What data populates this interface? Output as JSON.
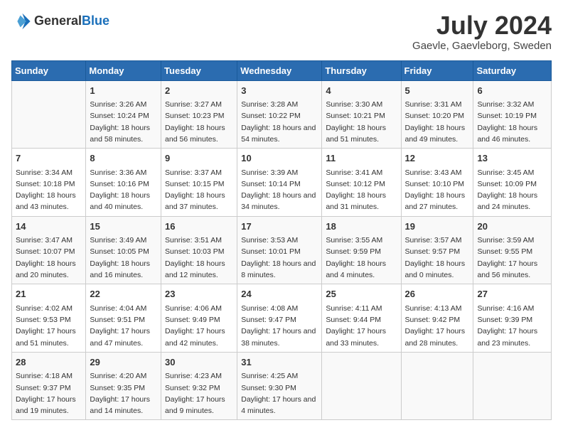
{
  "header": {
    "logo_general": "General",
    "logo_blue": "Blue",
    "month_year": "July 2024",
    "location": "Gaevle, Gaevleborg, Sweden"
  },
  "columns": [
    "Sunday",
    "Monday",
    "Tuesday",
    "Wednesday",
    "Thursday",
    "Friday",
    "Saturday"
  ],
  "weeks": [
    [
      {
        "day": "",
        "sunrise": "",
        "sunset": "",
        "daylight": ""
      },
      {
        "day": "1",
        "sunrise": "Sunrise: 3:26 AM",
        "sunset": "Sunset: 10:24 PM",
        "daylight": "Daylight: 18 hours and 58 minutes."
      },
      {
        "day": "2",
        "sunrise": "Sunrise: 3:27 AM",
        "sunset": "Sunset: 10:23 PM",
        "daylight": "Daylight: 18 hours and 56 minutes."
      },
      {
        "day": "3",
        "sunrise": "Sunrise: 3:28 AM",
        "sunset": "Sunset: 10:22 PM",
        "daylight": "Daylight: 18 hours and 54 minutes."
      },
      {
        "day": "4",
        "sunrise": "Sunrise: 3:30 AM",
        "sunset": "Sunset: 10:21 PM",
        "daylight": "Daylight: 18 hours and 51 minutes."
      },
      {
        "day": "5",
        "sunrise": "Sunrise: 3:31 AM",
        "sunset": "Sunset: 10:20 PM",
        "daylight": "Daylight: 18 hours and 49 minutes."
      },
      {
        "day": "6",
        "sunrise": "Sunrise: 3:32 AM",
        "sunset": "Sunset: 10:19 PM",
        "daylight": "Daylight: 18 hours and 46 minutes."
      }
    ],
    [
      {
        "day": "7",
        "sunrise": "Sunrise: 3:34 AM",
        "sunset": "Sunset: 10:18 PM",
        "daylight": "Daylight: 18 hours and 43 minutes."
      },
      {
        "day": "8",
        "sunrise": "Sunrise: 3:36 AM",
        "sunset": "Sunset: 10:16 PM",
        "daylight": "Daylight: 18 hours and 40 minutes."
      },
      {
        "day": "9",
        "sunrise": "Sunrise: 3:37 AM",
        "sunset": "Sunset: 10:15 PM",
        "daylight": "Daylight: 18 hours and 37 minutes."
      },
      {
        "day": "10",
        "sunrise": "Sunrise: 3:39 AM",
        "sunset": "Sunset: 10:14 PM",
        "daylight": "Daylight: 18 hours and 34 minutes."
      },
      {
        "day": "11",
        "sunrise": "Sunrise: 3:41 AM",
        "sunset": "Sunset: 10:12 PM",
        "daylight": "Daylight: 18 hours and 31 minutes."
      },
      {
        "day": "12",
        "sunrise": "Sunrise: 3:43 AM",
        "sunset": "Sunset: 10:10 PM",
        "daylight": "Daylight: 18 hours and 27 minutes."
      },
      {
        "day": "13",
        "sunrise": "Sunrise: 3:45 AM",
        "sunset": "Sunset: 10:09 PM",
        "daylight": "Daylight: 18 hours and 24 minutes."
      }
    ],
    [
      {
        "day": "14",
        "sunrise": "Sunrise: 3:47 AM",
        "sunset": "Sunset: 10:07 PM",
        "daylight": "Daylight: 18 hours and 20 minutes."
      },
      {
        "day": "15",
        "sunrise": "Sunrise: 3:49 AM",
        "sunset": "Sunset: 10:05 PM",
        "daylight": "Daylight: 18 hours and 16 minutes."
      },
      {
        "day": "16",
        "sunrise": "Sunrise: 3:51 AM",
        "sunset": "Sunset: 10:03 PM",
        "daylight": "Daylight: 18 hours and 12 minutes."
      },
      {
        "day": "17",
        "sunrise": "Sunrise: 3:53 AM",
        "sunset": "Sunset: 10:01 PM",
        "daylight": "Daylight: 18 hours and 8 minutes."
      },
      {
        "day": "18",
        "sunrise": "Sunrise: 3:55 AM",
        "sunset": "Sunset: 9:59 PM",
        "daylight": "Daylight: 18 hours and 4 minutes."
      },
      {
        "day": "19",
        "sunrise": "Sunrise: 3:57 AM",
        "sunset": "Sunset: 9:57 PM",
        "daylight": "Daylight: 18 hours and 0 minutes."
      },
      {
        "day": "20",
        "sunrise": "Sunrise: 3:59 AM",
        "sunset": "Sunset: 9:55 PM",
        "daylight": "Daylight: 17 hours and 56 minutes."
      }
    ],
    [
      {
        "day": "21",
        "sunrise": "Sunrise: 4:02 AM",
        "sunset": "Sunset: 9:53 PM",
        "daylight": "Daylight: 17 hours and 51 minutes."
      },
      {
        "day": "22",
        "sunrise": "Sunrise: 4:04 AM",
        "sunset": "Sunset: 9:51 PM",
        "daylight": "Daylight: 17 hours and 47 minutes."
      },
      {
        "day": "23",
        "sunrise": "Sunrise: 4:06 AM",
        "sunset": "Sunset: 9:49 PM",
        "daylight": "Daylight: 17 hours and 42 minutes."
      },
      {
        "day": "24",
        "sunrise": "Sunrise: 4:08 AM",
        "sunset": "Sunset: 9:47 PM",
        "daylight": "Daylight: 17 hours and 38 minutes."
      },
      {
        "day": "25",
        "sunrise": "Sunrise: 4:11 AM",
        "sunset": "Sunset: 9:44 PM",
        "daylight": "Daylight: 17 hours and 33 minutes."
      },
      {
        "day": "26",
        "sunrise": "Sunrise: 4:13 AM",
        "sunset": "Sunset: 9:42 PM",
        "daylight": "Daylight: 17 hours and 28 minutes."
      },
      {
        "day": "27",
        "sunrise": "Sunrise: 4:16 AM",
        "sunset": "Sunset: 9:39 PM",
        "daylight": "Daylight: 17 hours and 23 minutes."
      }
    ],
    [
      {
        "day": "28",
        "sunrise": "Sunrise: 4:18 AM",
        "sunset": "Sunset: 9:37 PM",
        "daylight": "Daylight: 17 hours and 19 minutes."
      },
      {
        "day": "29",
        "sunrise": "Sunrise: 4:20 AM",
        "sunset": "Sunset: 9:35 PM",
        "daylight": "Daylight: 17 hours and 14 minutes."
      },
      {
        "day": "30",
        "sunrise": "Sunrise: 4:23 AM",
        "sunset": "Sunset: 9:32 PM",
        "daylight": "Daylight: 17 hours and 9 minutes."
      },
      {
        "day": "31",
        "sunrise": "Sunrise: 4:25 AM",
        "sunset": "Sunset: 9:30 PM",
        "daylight": "Daylight: 17 hours and 4 minutes."
      },
      {
        "day": "",
        "sunrise": "",
        "sunset": "",
        "daylight": ""
      },
      {
        "day": "",
        "sunrise": "",
        "sunset": "",
        "daylight": ""
      },
      {
        "day": "",
        "sunrise": "",
        "sunset": "",
        "daylight": ""
      }
    ]
  ]
}
